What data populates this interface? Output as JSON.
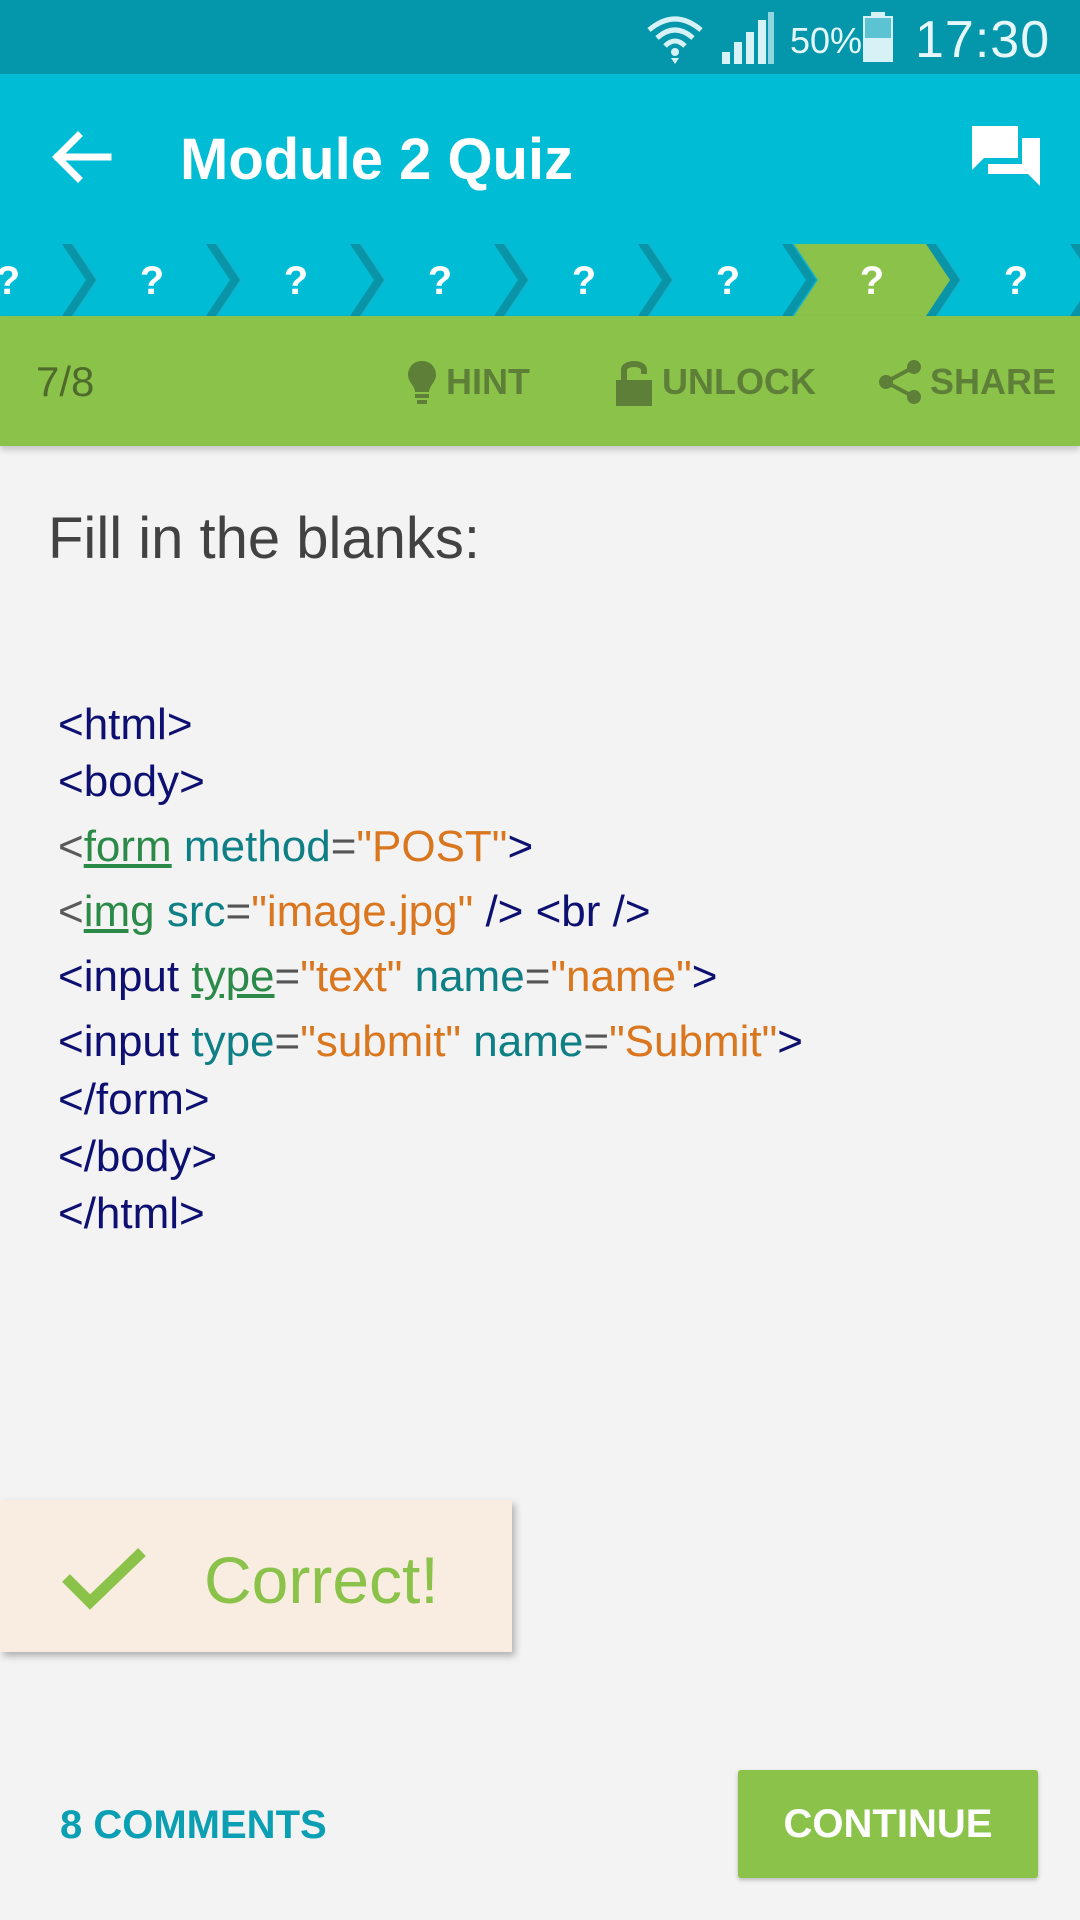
{
  "status_bar": {
    "battery_percent": "50%",
    "time": "17:30",
    "icons": [
      "wifi-icon",
      "signal-icon",
      "battery-icon"
    ]
  },
  "app_bar": {
    "title": "Module 2 Quiz",
    "icons": [
      "back-arrow-icon",
      "chat-icon"
    ]
  },
  "progress": {
    "steps": [
      "?",
      "?",
      "?",
      "?",
      "?",
      "?",
      "?",
      "?"
    ],
    "current_step": 7,
    "colors": {
      "done": "#00bcd4",
      "current": "#8bc34a"
    }
  },
  "toolbar": {
    "counter": "7/8",
    "hint_label": "HINT",
    "unlock_label": "UNLOCK",
    "share_label": "SHARE"
  },
  "question": {
    "prompt": "Fill in the blanks:",
    "code": {
      "line1": "<html>",
      "line2": "<body>",
      "line3": {
        "open": "<",
        "blank": "form",
        "attr": " method",
        "eq": "=",
        "str": "\"POST\"",
        "close": ">"
      },
      "line4": {
        "open": "<",
        "blank": "img",
        "attr": " src",
        "eq": "=",
        "str": "\"image.jpg\"",
        "rest": " /> <br />"
      },
      "line5": {
        "tag": "<input ",
        "blank": "type",
        "eq1": "=",
        "str1": "\"text\"",
        "attr2": " name",
        "eq2": "=",
        "str2": "\"name\"",
        "close": ">"
      },
      "line6": {
        "tag": "<input ",
        "attr1": "type",
        "eq1": "=",
        "str1": "\"submit\"",
        "attr2": " name",
        "eq2": "=",
        "str2": "\"Submit\"",
        "close": ">"
      },
      "line7": "</form>",
      "line8": "</body>",
      "line9": "</html>"
    }
  },
  "feedback": {
    "text": "Correct!",
    "icon": "checkmark-icon"
  },
  "footer": {
    "comments_label": "8 COMMENTS",
    "continue_label": "CONTINUE"
  }
}
